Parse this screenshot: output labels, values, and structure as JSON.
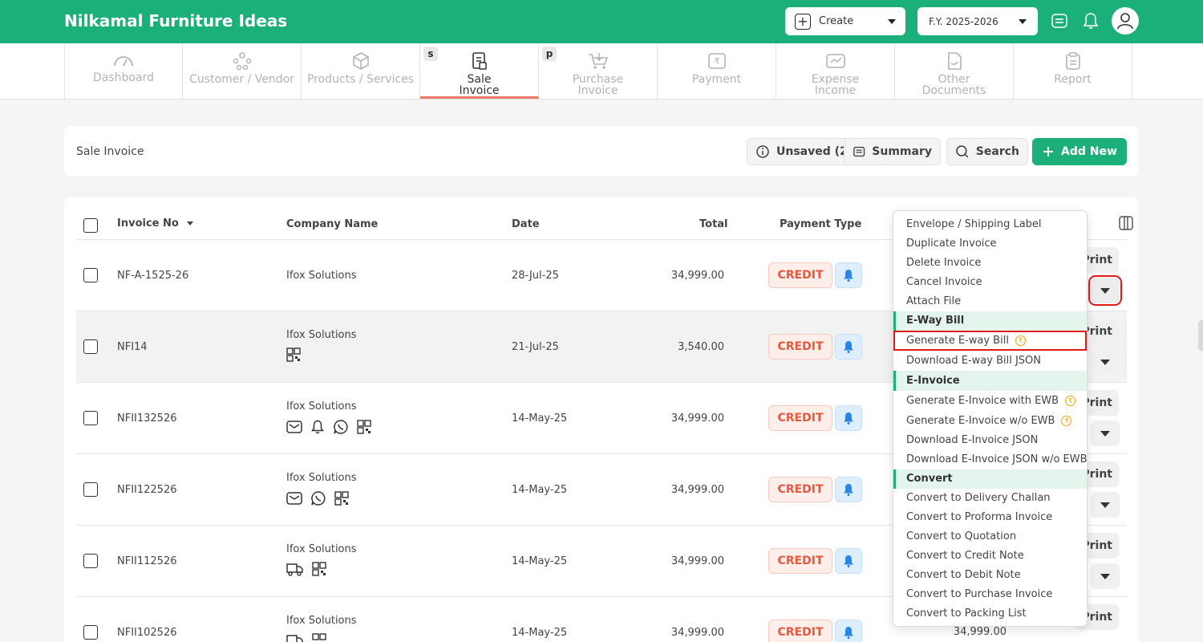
{
  "app": {
    "title": "Nilkamal Furniture Ideas"
  },
  "header": {
    "create_label": "Create",
    "fy_label": "F.Y. 2025-2026"
  },
  "tabs": [
    {
      "label": "Dashboard",
      "icon": "gauge-icon"
    },
    {
      "label": "Customer / Vendor",
      "icon": "users-icon"
    },
    {
      "label": "Products / Services",
      "icon": "box-icon"
    },
    {
      "label": "Sale Invoice",
      "icon": "invoice-icon",
      "key": "s",
      "active": true
    },
    {
      "label": "Purchase Invoice",
      "icon": "cart-icon",
      "key": "p"
    },
    {
      "label": "Payment",
      "icon": "rupee-note-icon"
    },
    {
      "label": "Expense Income",
      "icon": "expense-icon"
    },
    {
      "label": "Other Documents",
      "icon": "document-icon"
    },
    {
      "label": "Report",
      "icon": "clipboard-icon"
    }
  ],
  "page": {
    "title": "Sale Invoice",
    "unsaved_label": "Unsaved (2)",
    "summary_label": "Summary",
    "search_label": "Search",
    "add_new_label": "Add New"
  },
  "table": {
    "columns": {
      "invoice_no": "Invoice No",
      "company": "Company Name",
      "date": "Date",
      "total": "Total",
      "payment_type": "Payment Type"
    },
    "rows": [
      {
        "invoice_no": "NF-A-1525-26",
        "company": "Ifox Solutions",
        "date": "28-Jul-25",
        "total": "34,999.00",
        "payment": "CREDIT",
        "print": "Print",
        "icons": []
      },
      {
        "invoice_no": "NFI14",
        "company": "Ifox Solutions",
        "date": "21-Jul-25",
        "total": "3,540.00",
        "payment": "CREDIT",
        "print": "Print",
        "icons": [
          "qr-icon"
        ]
      },
      {
        "invoice_no": "NFII132526",
        "company": "Ifox Solutions",
        "date": "14-May-25",
        "total": "34,999.00",
        "payment": "CREDIT",
        "print": "Print",
        "icons": [
          "mail-icon",
          "bell-icon",
          "whatsapp-icon",
          "qr-icon"
        ]
      },
      {
        "invoice_no": "NFII122526",
        "company": "Ifox Solutions",
        "date": "14-May-25",
        "total": "34,999.00",
        "payment": "CREDIT",
        "print": "Print",
        "icons": [
          "mail-icon",
          "whatsapp-icon",
          "qr-icon"
        ]
      },
      {
        "invoice_no": "NFII112526",
        "company": "Ifox Solutions",
        "date": "14-May-25",
        "total": "34,999.00",
        "payment": "CREDIT",
        "print": "Print",
        "icons": [
          "truck-icon",
          "qr-icon"
        ]
      },
      {
        "invoice_no": "NFII102526",
        "company": "Ifox Solutions",
        "date": "14-May-25",
        "total": "34,999.00",
        "payment": "CREDIT",
        "print": "Print",
        "extra_total": "34,999.00",
        "icons": [
          "truck-icon",
          "qr-icon"
        ]
      }
    ]
  },
  "menu": {
    "items": [
      {
        "label": "Envelope / Shipping Label"
      },
      {
        "label": "Duplicate Invoice"
      },
      {
        "label": "Delete Invoice"
      },
      {
        "label": "Cancel Invoice"
      },
      {
        "label": "Attach File"
      },
      {
        "label": "E-Way Bill",
        "section": true
      },
      {
        "label": "Generate E-way Bill",
        "coin": true,
        "highlight": true
      },
      {
        "label": "Download E-way Bill JSON"
      },
      {
        "label": "E-Invoice",
        "section": true
      },
      {
        "label": "Generate E-Invoice with EWB",
        "coin": true
      },
      {
        "label": "Generate E-Invoice w/o EWB",
        "coin": true
      },
      {
        "label": "Download E-Invoice JSON"
      },
      {
        "label": "Download E-Invoice JSON w/o EWB"
      },
      {
        "label": "Convert",
        "section": true
      },
      {
        "label": "Convert to Delivery Challan"
      },
      {
        "label": "Convert to Proforma Invoice"
      },
      {
        "label": "Convert to Quotation"
      },
      {
        "label": "Convert to Credit Note"
      },
      {
        "label": "Convert to Debit Note"
      },
      {
        "label": "Convert to Purchase Invoice"
      },
      {
        "label": "Convert to Packing List"
      }
    ]
  },
  "colors": {
    "brand": "#1bb07a",
    "credit": "#e8583f",
    "highlight": "#e01919"
  }
}
